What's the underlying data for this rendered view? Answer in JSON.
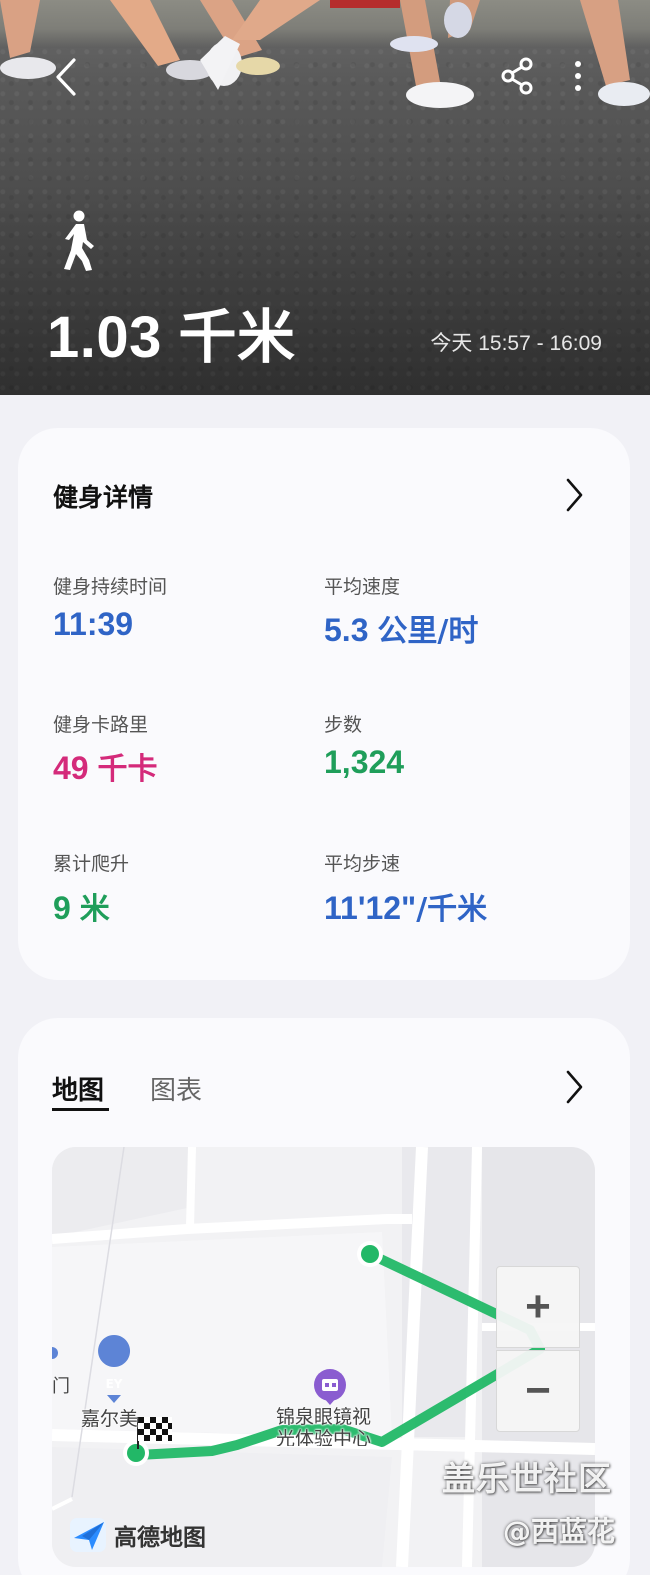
{
  "hero": {
    "distance": "1.03 千米",
    "time_range": "今天 15:57 - 16:09",
    "activity_icon": "walking-person-icon",
    "back_icon": "chevron-left-icon",
    "share_icon": "share-icon",
    "more_icon": "more-vertical-icon"
  },
  "details": {
    "title": "健身详情",
    "metrics": [
      {
        "label": "健身持续时间",
        "value": "11:39",
        "unit": "",
        "color": "#2f64c6"
      },
      {
        "label": "平均速度",
        "value": "5.3",
        "unit": "公里/时",
        "color": "#2f64c6"
      },
      {
        "label": "健身卡路里",
        "value": "49",
        "unit": "千卡",
        "color": "#d42a7a"
      },
      {
        "label": "步数",
        "value": "1,324",
        "unit": "",
        "color": "#1f9e5a"
      },
      {
        "label": "累计爬升",
        "value": "9",
        "unit": "米",
        "color": "#1f9e5a"
      },
      {
        "label": "平均步速",
        "value": "11'12\"",
        "unit": "/千米",
        "color": "#2f64c6"
      }
    ]
  },
  "map_section": {
    "tabs": [
      {
        "label": "地图",
        "active": true
      },
      {
        "label": "图表",
        "active": false
      }
    ],
    "zoom_in": "+",
    "zoom_out": "−",
    "poi": [
      {
        "name": "嘉尔美"
      },
      {
        "name": "锦泉眼镜视光体验中心"
      }
    ],
    "partial_label": "门",
    "provider": "高德地图",
    "route_color": "#22b867"
  },
  "watermark": {
    "line1": "盖乐世社区",
    "line2": "@西蓝花"
  }
}
